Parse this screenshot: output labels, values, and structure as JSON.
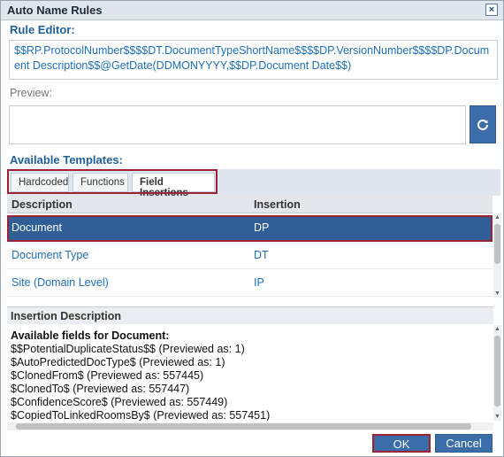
{
  "dialog": {
    "title": "Auto Name Rules",
    "close_glyph": "×"
  },
  "rule_editor": {
    "label": "Rule Editor:",
    "value": "$$RP.ProtocolNumber$$$$DT.DocumentTypeShortName$$$$DP.VersionNumber$$$$DP.Document Description$$@GetDate(DDMONYYYY,$$DP.Document Date$$)"
  },
  "preview": {
    "label": "Preview:",
    "value": "",
    "refresh_icon": "refresh-icon"
  },
  "templates": {
    "label": "Available Templates:",
    "tabs": [
      {
        "label": "Hardcoded",
        "active": false
      },
      {
        "label": "Functions",
        "active": false
      },
      {
        "label": "Field Insertions",
        "active": true
      }
    ],
    "columns": [
      "Description",
      "Insertion"
    ],
    "rows": [
      {
        "description": "Document",
        "insertion": "DP",
        "selected": true
      },
      {
        "description": "Document Type",
        "insertion": "DT",
        "selected": false
      },
      {
        "description": "Site (Domain Level)",
        "insertion": "IP",
        "selected": false
      }
    ]
  },
  "insertion_description": {
    "label": "Insertion Description",
    "title": "Available fields for Document:",
    "lines": [
      "$$PotentialDuplicateStatus$$ (Previewed as: 1)",
      "$AutoPredictedDocType$ (Previewed as: 1)",
      "$ClonedFrom$ (Previewed as: 557445)",
      "$ClonedTo$ (Previewed as: 557447)",
      "$ConfidenceScore$ (Previewed as: 557449)",
      "$CopiedToLinkedRoomsBy$ (Previewed as: 557451)"
    ]
  },
  "footer": {
    "ok_label": "OK",
    "cancel_label": "Cancel"
  },
  "colors": {
    "accent": "#3b6ea9",
    "selected_row": "#2f5f96",
    "highlight_outline": "#9b2335",
    "link_text": "#1f6fb8"
  }
}
